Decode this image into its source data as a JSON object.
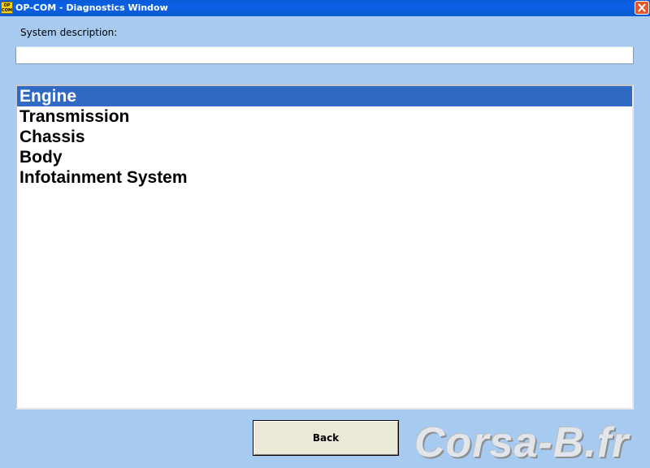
{
  "window": {
    "title": "OP-COM - Diagnostics Window",
    "app_icon_text": "OP COM"
  },
  "system_description": {
    "label": "System description:",
    "value": ""
  },
  "systems_list": {
    "selected_index": 0,
    "items": [
      "Engine",
      "Transmission",
      "Chassis",
      "Body",
      "Infotainment System"
    ]
  },
  "buttons": {
    "back": "Back"
  },
  "watermark": "Corsa-B.fr",
  "colors": {
    "background": "#a6caf0",
    "titlebar": "#0b62e6",
    "selection": "#316ac5"
  }
}
